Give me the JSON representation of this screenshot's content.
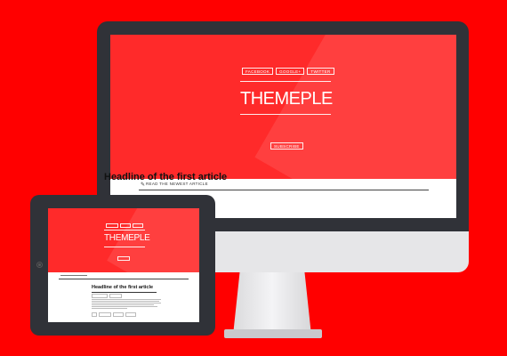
{
  "colors": {
    "background": "#ff0000",
    "hero": "#ff2a2a",
    "device_dark": "#303238",
    "device_light": "#e6e6e8"
  },
  "desktop": {
    "social_buttons": [
      "FACEBOOK",
      "GOOGLE+",
      "TWITTER"
    ],
    "logo": "THEMEPLE",
    "subscribe_label": "SUBSCRIBE",
    "pen_icon": "pen-icon",
    "section_label": "READ THE NEWEST ARTICLE",
    "headline": "Headline of the first article"
  },
  "tablet": {
    "logo": "THEMEPLE",
    "headline": "Headline of the first article"
  }
}
